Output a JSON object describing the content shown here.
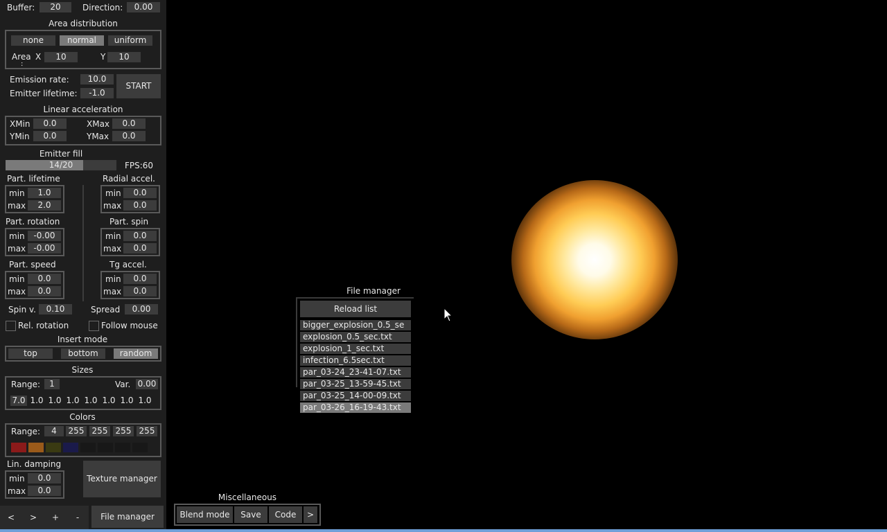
{
  "top": {
    "buffer_label": "Buffer:",
    "buffer_value": "20",
    "direction_label": "Direction:",
    "direction_value": "0.00"
  },
  "area": {
    "title": "Area distribution",
    "modes": [
      "none",
      "normal",
      "uniform"
    ],
    "active_mode": "normal",
    "area_label": "Area",
    "area_colon": ":",
    "x_label": "X",
    "x_value": "10",
    "y_label": "Y",
    "y_value": "10"
  },
  "emission": {
    "rate_label": "Emission rate:",
    "rate_value": "10.0",
    "lifetime_label": "Emitter lifetime:",
    "lifetime_value": "-1.0",
    "start_label": "START"
  },
  "linear": {
    "title": "Linear acceleration",
    "xmin_label": "XMin",
    "xmin_value": "0.0",
    "xmax_label": "XMax",
    "xmax_value": "0.0",
    "ymin_label": "YMin",
    "ymin_value": "0.0",
    "ymax_label": "YMax",
    "ymax_value": "0.0"
  },
  "fill": {
    "title": "Emitter fill",
    "text": "14/20",
    "fraction": 0.7,
    "fps": "FPS:60"
  },
  "minmax": {
    "min_label": "min",
    "max_label": "max",
    "lifetime": {
      "title": "Part. lifetime",
      "min": "1.0",
      "max": "2.0"
    },
    "radial": {
      "title": "Radial accel.",
      "min": "0.0",
      "max": "0.0"
    },
    "rotation": {
      "title": "Part. rotation",
      "min": "-0.00",
      "max": "-0.00"
    },
    "spin": {
      "title": "Part. spin",
      "min": "0.0",
      "max": "0.0"
    },
    "speed": {
      "title": "Part. speed",
      "min": "0.0",
      "max": "0.0"
    },
    "tg": {
      "title": "Tg accel.",
      "min": "0.0",
      "max": "0.0"
    }
  },
  "misc_fields": {
    "spin_v_label": "Spin v.",
    "spin_v_value": "0.10",
    "spread_label": "Spread",
    "spread_value": "0.00",
    "rel_rotation_label": "Rel. rotation",
    "follow_mouse_label": "Follow mouse"
  },
  "insert": {
    "title": "Insert mode",
    "modes": [
      "top",
      "bottom",
      "random"
    ],
    "active_mode": "random"
  },
  "sizes": {
    "title": "Sizes",
    "range_label": "Range:",
    "range_value": "1",
    "var_label": "Var.",
    "var_value": "0.00",
    "values": [
      "7.0",
      "1.0",
      "1.0",
      "1.0",
      "1.0",
      "1.0",
      "1.0",
      "1.0"
    ]
  },
  "colors": {
    "title": "Colors",
    "range_label": "Range:",
    "range_value": "4",
    "channels": [
      "255",
      "255",
      "255",
      "255"
    ],
    "swatches": [
      "#8b1a1a",
      "#9a5a1a",
      "#3a3a12",
      "#1a1a4a",
      "#181818",
      "#181818",
      "#181818",
      "#181818"
    ]
  },
  "damping": {
    "title": "Lin. damping",
    "min": "0.0",
    "max": "0.0"
  },
  "texture_manager_label": "Texture manager",
  "nav": {
    "prev": "<",
    "next": ">",
    "add": "+",
    "remove": "-",
    "file_manager": "File manager"
  },
  "misc": {
    "title": "Miscellaneous",
    "blend": "Blend mode",
    "save": "Save",
    "code": "Code",
    "more": ">"
  },
  "file_manager": {
    "title": "File manager",
    "reload": "Reload list",
    "files": [
      "bigger_explosion_0.5_se",
      "explosion_0.5_sec.txt",
      "explosion_1_sec.txt",
      "infection_6.5sec.txt",
      "par_03-24_23-41-07.txt",
      "par_03-25_13-59-45.txt",
      "par_03-25_14-00-09.txt",
      "par_03-26_16-19-43.txt"
    ],
    "selected_index": 7
  }
}
